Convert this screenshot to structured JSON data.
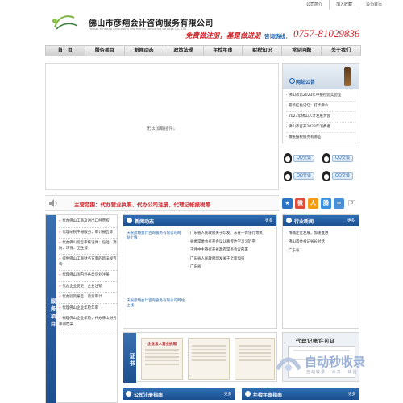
{
  "top_links": [
    "公司简介",
    "加入收藏",
    "设为首页"
  ],
  "header": {
    "logo_text": "彦翔会计",
    "company_name": "佛山市彦翔会计咨询服务有限公司",
    "company_en": "Foshan Yanxiang accounting information consulting services Co., LTD",
    "slogan": "免费做注册，基是做进册",
    "hotline_label": "咨询热线：",
    "hotline": "0757-81029836"
  },
  "nav": [
    "首　页",
    "服务项目",
    "新闻动态",
    "政策法规",
    "年检年审",
    "财税知识",
    "常见问题",
    "关于我们"
  ],
  "banner": {
    "message": "无法加载插件。"
  },
  "notice": {
    "title": "网站公告",
    "items": [
      "佛山市第2023年申报检验实验室",
      "最新红色记忆：打卡佛山",
      "2023年佛山人才发展大会",
      "佛山市召开2023年消费者",
      "做账报税服务有哪些"
    ]
  },
  "qq": {
    "button_label": "QQ交谈"
  },
  "scope": {
    "text": "主营范围：代办营业执照、代办公司注册、代理记帐报税等"
  },
  "share": {
    "count": "0"
  },
  "services": {
    "side_title": "服务项目",
    "items": [
      "代办佛山工商及进出口经营权",
      "代理纳税申报服务，审计报告等",
      "代办佛山控告审核证件：包括：消防、环保、卫生等",
      "提供佛山工商财务方面的新法规咨询",
      "代理佛山国内外各类企业注册",
      "代办企业变更，企业注销",
      "代办验资报告，验资审计",
      "代理佛山企业年检年审",
      "代理佛山企业年检，代办佛山财务审阅档案"
    ]
  },
  "news": {
    "title": "新闻动态",
    "more": "更多",
    "img_caption_1": "庆祝彦翔会计咨询服务有限公司网站上线",
    "img_caption_2": "庆祝彦翔会计咨询服务有限公司网站上线",
    "items": [
      "广东省人民政府关于印发广东省一体化行政执",
      "省委常委会召开会议认真传达学习习近平",
      "王伟中主持召开省政府常务会议部署",
      "广东省人民政府印发关于全面加强",
      "广东省"
    ]
  },
  "industry": {
    "title": "行业新闻",
    "more": "更多",
    "items": [
      "精确定位发展，加速推进",
      "佛山市委书记省长对话",
      "广东省"
    ]
  },
  "cert": {
    "side_title": "证书",
    "doc_heading": "企业法人营业执照"
  },
  "permit": {
    "title": "代理记账许可证"
  },
  "watermark": {
    "title": "自动秒收录",
    "sub": "自动收录 · 未来 · 体验"
  },
  "footer_sections": [
    {
      "title": "公司注册指南",
      "more": "更多"
    },
    {
      "title": "年检年审指南",
      "more": "更多"
    }
  ],
  "colors": {
    "brand_blue": "#1d5fa8",
    "accent_red": "#d0242a"
  }
}
